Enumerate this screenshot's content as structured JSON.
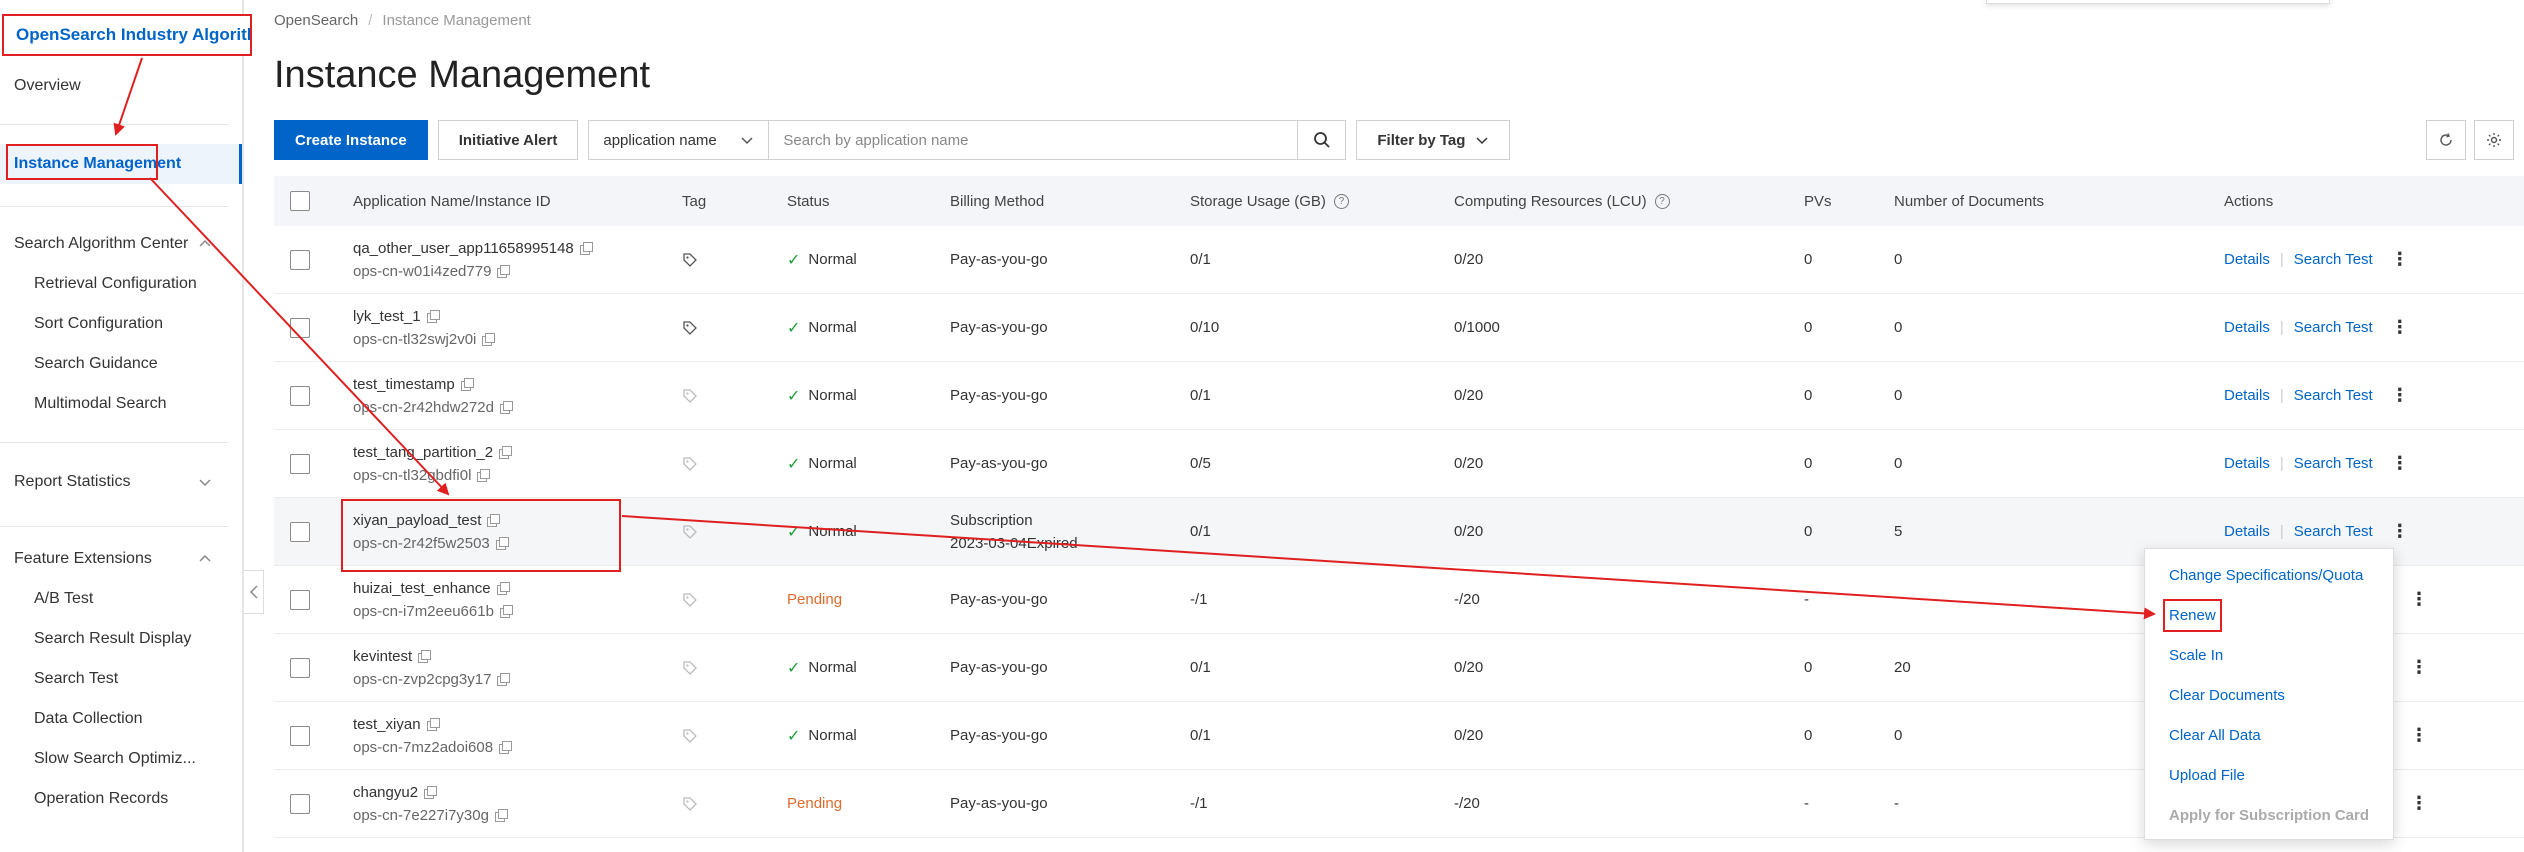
{
  "sidebar": {
    "brand": "OpenSearch Industry Algorithm",
    "overview": "Overview",
    "instance_management": "Instance Management",
    "search_algorithm_center": "Search Algorithm Center",
    "retrieval_configuration": "Retrieval Configuration",
    "sort_configuration": "Sort Configuration",
    "search_guidance": "Search Guidance",
    "multimodal_search": "Multimodal Search",
    "report_statistics": "Report Statistics",
    "feature_extensions": "Feature Extensions",
    "ab_test": "A/B Test",
    "search_result_display": "Search Result Display",
    "search_test": "Search Test",
    "data_collection": "Data Collection",
    "slow_search": "Slow Search Optimiz...",
    "operation_records": "Operation Records"
  },
  "breadcrumb": {
    "root": "OpenSearch",
    "sep": "/",
    "current": "Instance Management"
  },
  "page_title": "Instance Management",
  "toolbar": {
    "create": "Create Instance",
    "alert": "Initiative Alert",
    "search_type": "application name",
    "search_placeholder": "Search by application name",
    "filter_tag": "Filter by Tag"
  },
  "table": {
    "headers": {
      "name": "Application Name/Instance ID",
      "tag": "Tag",
      "status": "Status",
      "billing": "Billing Method",
      "storage": "Storage Usage (GB)",
      "compute": "Computing Resources (LCU)",
      "pvs": "PVs",
      "docs": "Number of Documents",
      "actions": "Actions"
    },
    "rows": [
      {
        "name": "qa_other_user_app11658995148",
        "id": "ops-cn-w01i4zed779",
        "status": "Normal",
        "billing": "Pay-as-you-go",
        "billing2": "",
        "storage": "0/1",
        "compute": "0/20",
        "pvs": "0",
        "docs": "0",
        "details": "Details",
        "search_test": "Search Test"
      },
      {
        "name": "lyk_test_1",
        "id": "ops-cn-tl32swj2v0i",
        "status": "Normal",
        "billing": "Pay-as-you-go",
        "billing2": "",
        "storage": "0/10",
        "compute": "0/1000",
        "pvs": "0",
        "docs": "0",
        "details": "Details",
        "search_test": "Search Test"
      },
      {
        "name": "test_timestamp",
        "id": "ops-cn-2r42hdw272d",
        "status": "Normal",
        "billing": "Pay-as-you-go",
        "billing2": "",
        "storage": "0/1",
        "compute": "0/20",
        "pvs": "0",
        "docs": "0",
        "details": "Details",
        "search_test": "Search Test"
      },
      {
        "name": "test_tang_partition_2",
        "id": "ops-cn-tl32gbdfi0l",
        "status": "Normal",
        "billing": "Pay-as-you-go",
        "billing2": "",
        "storage": "0/5",
        "compute": "0/20",
        "pvs": "0",
        "docs": "0",
        "details": "Details",
        "search_test": "Search Test"
      },
      {
        "name": "xiyan_payload_test",
        "id": "ops-cn-2r42f5w2503",
        "status": "Normal",
        "billing": "Subscription",
        "billing2": "2023-03-04Expired",
        "storage": "0/1",
        "compute": "0/20",
        "pvs": "0",
        "docs": "5",
        "details": "Details",
        "search_test": "Search Test"
      },
      {
        "name": "huizai_test_enhance",
        "id": "ops-cn-i7m2eeu661b",
        "status": "Pending",
        "billing": "Pay-as-you-go",
        "billing2": "",
        "storage": "-/1",
        "compute": "-/20",
        "pvs": "-",
        "docs": "",
        "details": "",
        "search_test": ""
      },
      {
        "name": "kevintest",
        "id": "ops-cn-zvp2cpg3y17",
        "status": "Normal",
        "billing": "Pay-as-you-go",
        "billing2": "",
        "storage": "0/1",
        "compute": "0/20",
        "pvs": "0",
        "docs": "20",
        "details": "",
        "search_test": ""
      },
      {
        "name": "test_xiyan",
        "id": "ops-cn-7mz2adoi608",
        "status": "Normal",
        "billing": "Pay-as-you-go",
        "billing2": "",
        "storage": "0/1",
        "compute": "0/20",
        "pvs": "0",
        "docs": "0",
        "details": "",
        "search_test": ""
      },
      {
        "name": "changyu2",
        "id": "ops-cn-7e227i7y30g",
        "status": "Pending",
        "billing": "Pay-as-you-go",
        "billing2": "",
        "storage": "-/1",
        "compute": "-/20",
        "pvs": "-",
        "docs": "-",
        "details": "",
        "search_test": ""
      }
    ]
  },
  "menu": {
    "change_spec": "Change Specifications/Quota",
    "renew": "Renew",
    "scale_in": "Scale In",
    "clear_documents": "Clear Documents",
    "clear_all_data": "Clear All Data",
    "upload_file": "Upload File",
    "apply_sub": "Apply for Subscription Card"
  },
  "colors": {
    "accent": "#0064c8",
    "annotation": "#e02020",
    "normal": "#1e9e3a",
    "pending": "#e06a2c"
  }
}
